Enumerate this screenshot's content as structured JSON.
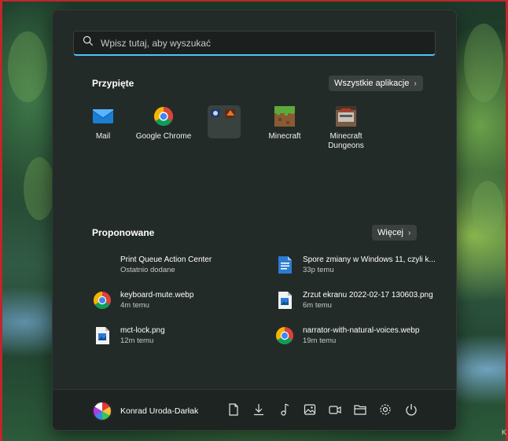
{
  "search": {
    "placeholder": "Wpisz tutaj, aby wyszukać"
  },
  "pinned": {
    "title": "Przypięte",
    "all_apps_label": "Wszystkie aplikacje",
    "items": [
      {
        "label": "Mail",
        "icon": "mail-icon"
      },
      {
        "label": "Google Chrome",
        "icon": "chrome-icon"
      },
      {
        "label": "",
        "icon": "folder-icon"
      },
      {
        "label": "Minecraft",
        "icon": "minecraft-icon"
      },
      {
        "label": "Minecraft Dungeons",
        "icon": "minecraft-dungeons-icon"
      }
    ]
  },
  "recommended": {
    "title": "Proponowane",
    "more_label": "Więcej",
    "items": [
      {
        "name": "Print Queue Action Center",
        "sub": "Ostatnio dodane",
        "icon": "blank-icon"
      },
      {
        "name": "Spore zmiany w Windows 11, czyli k...",
        "sub": "33p temu",
        "icon": "document-icon"
      },
      {
        "name": "keyboard-mute.webp",
        "sub": "4m temu",
        "icon": "chrome-icon"
      },
      {
        "name": "Zrzut ekranu 2022-02-17 130603.png",
        "sub": "6m temu",
        "icon": "image-file-icon"
      },
      {
        "name": "mct-lock.png",
        "sub": "12m temu",
        "icon": "image-file-icon"
      },
      {
        "name": "narrator-with-natural-voices.webp",
        "sub": "19m temu",
        "icon": "chrome-icon"
      }
    ]
  },
  "footer": {
    "user_name": "Konrad Uroda-Darłak",
    "buttons": [
      "documents-icon",
      "downloads-icon",
      "music-icon",
      "pictures-icon",
      "videos-icon",
      "file-explorer-icon",
      "settings-icon",
      "power-icon"
    ]
  },
  "colors": {
    "accent": "#4cc2ff",
    "menu_bg": "#232b29",
    "footer_bg": "#1d2422"
  },
  "corner_text": "K"
}
